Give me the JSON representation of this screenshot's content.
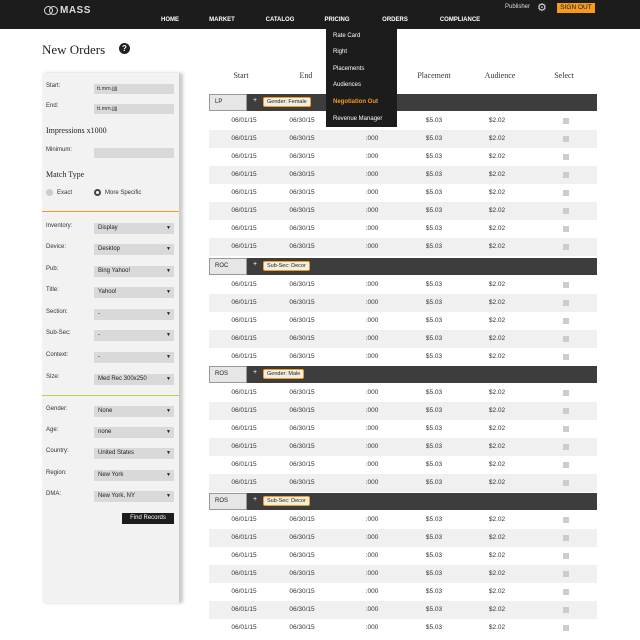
{
  "app": {
    "logo": "MASS",
    "publisher_label": "Publisher",
    "signout_label": "SIGN OUT"
  },
  "nav": {
    "items": [
      "HOME",
      "MARKET",
      "CATALOG",
      "PRICING",
      "ORDERS",
      "COMPLIANCE"
    ]
  },
  "pricing_menu": {
    "items": [
      "Rate Card",
      "Right",
      "Placements",
      "Audiences",
      "Negotiation Out",
      "Revenue Manager"
    ],
    "active": "Negotiation Out"
  },
  "page": {
    "title": "New Orders"
  },
  "filters": {
    "start_label": "Start:",
    "start_placeholder": "tt.mm.jjjj",
    "end_label": "End:",
    "end_placeholder": "tt.mm.jjjj",
    "impressions_title": "Impressions x1000",
    "minimum_label": "Minimum:",
    "match_type_title": "Match Type",
    "match_exact": "Exact",
    "match_more": "More Specific",
    "inventory_label": "Inventory:",
    "inventory_value": "Display",
    "device_label": "Device:",
    "device_value": "Desktop",
    "pub_label": "Pub:",
    "pub_value": "Bing Yahoo!",
    "title_label": "Title:",
    "title_value": "Yahoo!",
    "section_label": "Section:",
    "section_value": "-",
    "subsec_label": "Sub-Sec:",
    "subsec_value": "-",
    "context_label": "Context:",
    "context_value": "-",
    "size_label": "Size:",
    "size_value": "Med Rec 300x250",
    "gender_label": "Gender:",
    "gender_value": "None",
    "age_label": "Age:",
    "age_value": "none",
    "country_label": "Country:",
    "country_value": "United States",
    "region_label": "Region:",
    "region_value": "New York",
    "dma_label": "DMA:",
    "dma_value": "New York, NY",
    "find_label": "Find Records"
  },
  "table": {
    "headers": [
      "Start",
      "End",
      "Placement",
      "Audience",
      "Select"
    ],
    "row_values": {
      "start": "06/01/15",
      "end": "06/30/15",
      "imps": ":000",
      "placement": "$5.03",
      "audience": "$2.02"
    },
    "groups": [
      {
        "name": "LP",
        "plus": "+",
        "tag": "Gender: Female"
      },
      {
        "name": "ROC",
        "plus": "+",
        "tag": "Sub-Sec: Decor"
      },
      {
        "name": "ROS",
        "plus": "+",
        "tag": "Gender: Male"
      },
      {
        "name": "ROS",
        "plus": "+",
        "tag": "Sub-Sec: Decor"
      }
    ]
  },
  "colors": {
    "accent": "#f39a1f",
    "dark": "#1c1c1c",
    "group_bar": "#3d3d3d"
  }
}
